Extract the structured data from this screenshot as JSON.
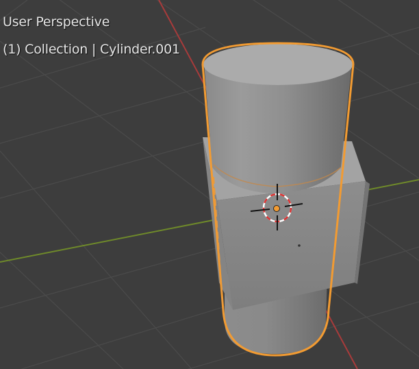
{
  "viewport": {
    "view_mode": "User Perspective",
    "frame": "(1)",
    "collection": "Collection",
    "separator": "|",
    "active_object": "Cylinder.001"
  },
  "objects": [
    {
      "name": "Cylinder.001",
      "type": "cylinder",
      "selected": true,
      "active": true
    },
    {
      "name": "Cube",
      "type": "cube",
      "selected": false
    }
  ],
  "colors": {
    "background": "#3d3d3d",
    "grid": "#4a4a4a",
    "x_axis": "#a93b3b",
    "y_axis": "#6f8a2a",
    "selection_outline": "#f29b32",
    "mesh_gray": "#9a9a9a"
  },
  "icons": {
    "cursor": "3d-cursor-icon",
    "origin": "object-origin-icon"
  }
}
